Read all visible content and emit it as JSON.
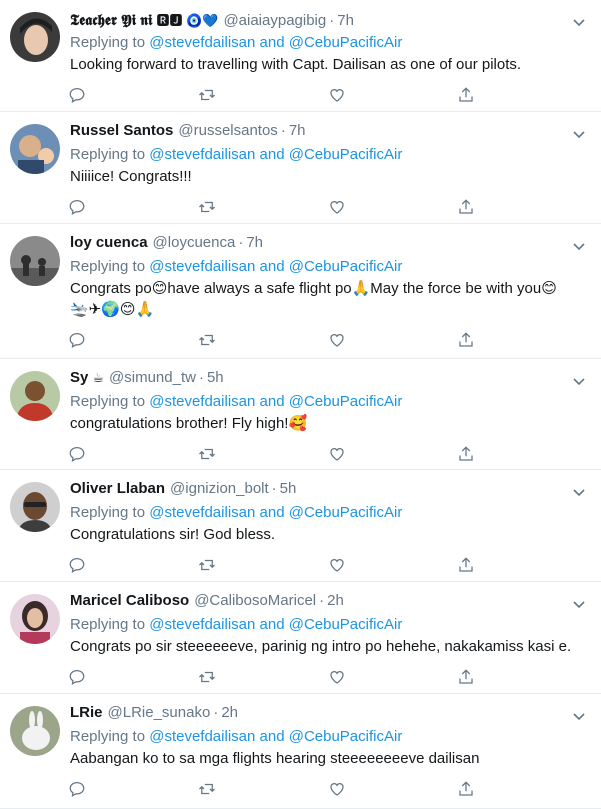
{
  "tweets": [
    {
      "name": "𝕿𝖊𝖆𝖈𝖍𝖊𝖗 𝖄𝖎 𝖓𝖎",
      "badges": "🆁🅹 🧿💙",
      "handle": "@aiaiaypagibig",
      "time": "7h",
      "replying_prefix": "Replying to",
      "mention1": "@stevefdailisan",
      "and": "and",
      "mention2": "@CebuPacificAir",
      "text": "Looking forward to travelling with Capt. Dailisan as one of our pilots.",
      "avatar_colors": [
        "#3b3b3b",
        "#e8c9b0"
      ]
    },
    {
      "name": "Russel Santos",
      "badges": "",
      "handle": "@russelsantos",
      "time": "7h",
      "replying_prefix": "Replying to",
      "mention1": "@stevefdailisan",
      "and": "and",
      "mention2": "@CebuPacificAir",
      "text": "Niiiice! Congrats!!!",
      "avatar_colors": [
        "#6d8fb5",
        "#d9b08c"
      ]
    },
    {
      "name": "loy cuenca",
      "badges": "",
      "handle": "@loycuenca",
      "time": "7h",
      "replying_prefix": "Replying to",
      "mention1": "@stevefdailisan",
      "and": "and",
      "mention2": "@CebuPacificAir",
      "text": "Congrats po😊have always a safe flight po🙏May the force be with you😊",
      "text2": "🛬✈🌍😊🙏",
      "avatar_colors": [
        "#8a8a8a",
        "#2e2e2e"
      ]
    },
    {
      "name": "Sy",
      "badges": "☕",
      "handle": "@simund_tw",
      "time": "5h",
      "replying_prefix": "Replying to",
      "mention1": "@stevefdailisan",
      "and": "and",
      "mention2": "@CebuPacificAir",
      "text": "congratulations brother! Fly high!🥰",
      "avatar_colors": [
        "#c0392b",
        "#7a5230"
      ]
    },
    {
      "name": "Oliver Llaban",
      "badges": "",
      "handle": "@ignizion_bolt",
      "time": "5h",
      "replying_prefix": "Replying to",
      "mention1": "@stevefdailisan",
      "and": "and",
      "mention2": "@CebuPacificAir",
      "text": "Congratulations sir! God bless.",
      "avatar_colors": [
        "#cfcfcf",
        "#6b4a34"
      ]
    },
    {
      "name": "Maricel Caliboso",
      "badges": "",
      "handle": "@CalibosoMaricel",
      "time": "2h",
      "replying_prefix": "Replying to",
      "mention1": "@stevefdailisan",
      "and": "and",
      "mention2": "@CebuPacificAir",
      "text": "Congrats po sir steeeeeeve, parinig ng intro po hehehe, nakakamiss kasi e.",
      "avatar_colors": [
        "#e6d3df",
        "#3a2a2a"
      ]
    },
    {
      "name": "LRie",
      "badges": "",
      "handle": "@LRie_sunako",
      "time": "2h",
      "replying_prefix": "Replying to",
      "mention1": "@stevefdailisan",
      "and": "and",
      "mention2": "@CebuPacificAir",
      "text": "Aabangan ko to sa mga flights hearing steeeeeeeeve dailisan",
      "avatar_colors": [
        "#9aa58a",
        "#f2f2f2"
      ]
    }
  ],
  "icons": {
    "reply": "reply-icon",
    "retweet": "retweet-icon",
    "like": "heart-icon",
    "share": "share-icon",
    "more": "chevron-down-icon"
  },
  "colors": {
    "mention": "#1b95e0",
    "muted": "#657786",
    "text": "#14171a",
    "divider": "#e6ecf0"
  }
}
